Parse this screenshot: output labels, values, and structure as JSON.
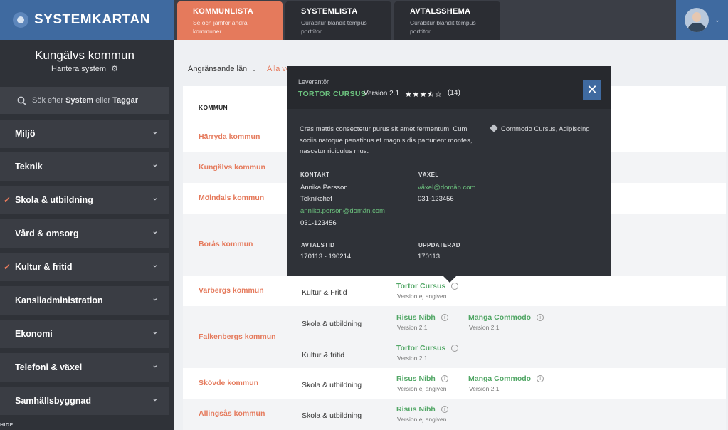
{
  "app": {
    "logo": "SYSTEMKARTAN"
  },
  "tabs": [
    {
      "title": "KOMMUNLISTA",
      "subtitle": "Se och jämför andra kommuner"
    },
    {
      "title": "SYSTEMLISTA",
      "subtitle": "Curabitur blandit tempus porttitor."
    },
    {
      "title": "AVTALSSHEMA",
      "subtitle": "Curabitur blandit tempus porttitor."
    }
  ],
  "sidebar": {
    "municipality": "Kungälvs kommun",
    "manage_label": "Hantera system",
    "search": {
      "prefix": "Sök efter ",
      "bold1": "System",
      "middle": " eller ",
      "bold2": "Taggar"
    },
    "categories": [
      {
        "label": "Miljö",
        "checked": false
      },
      {
        "label": "Teknik",
        "checked": false
      },
      {
        "label": "Skola & utbildning",
        "checked": true
      },
      {
        "label": "Vård & omsorg",
        "checked": false
      },
      {
        "label": "Kultur & fritid",
        "checked": true
      },
      {
        "label": "Kansliadministration",
        "checked": false
      },
      {
        "label": "Ekonomi",
        "checked": false
      },
      {
        "label": "Telefoni & växel",
        "checked": false
      },
      {
        "label": "Samhällsbyggnad",
        "checked": false
      }
    ],
    "hide_label": "HIDE"
  },
  "filter": {
    "neighbors": "Angränsande län",
    "all": "Alla ve"
  },
  "table": {
    "header_kommun": "KOMMUN",
    "rows": [
      {
        "kommun": "Härryda kommun"
      },
      {
        "kommun": "Kungälvs kommun"
      },
      {
        "kommun": "Mölndals kommun"
      },
      {
        "kommun": "Borås kommun"
      },
      {
        "kommun": "Varbergs kommun",
        "area": "Kultur & Fritid",
        "sys1": "Tortor Cursus",
        "ver1": "Version ej angiven"
      },
      {
        "kommun": "Falkenbergs kommun",
        "area": "Skola & utbildning",
        "sys1": "Risus Nibh",
        "ver1": "Version 2.1",
        "sys2": "Manga Commodo",
        "ver2": "Version 2.1",
        "area_b": "Kultur & fritid",
        "sys1_b": "Tortor Cursus",
        "ver1_b": "Version 2.1"
      },
      {
        "kommun": "Skövde kommun",
        "area": "Skola & utbildning",
        "sys1": "Risus Nibh",
        "ver1": "Version ej angiven",
        "sys2": "Manga Commodo",
        "ver2": "Version 2.1"
      },
      {
        "kommun": "Allingsås kommun",
        "area": "Skola & utbildning",
        "sys1": "Risus Nibh",
        "ver1": "Version ej angiven"
      }
    ]
  },
  "popup": {
    "supplier_label": "Leverantör",
    "system": "TORTOR CURSUS",
    "version": "Version 2.1",
    "stars": "★★★⯪☆",
    "rating_count": "(14)",
    "description": "Cras mattis consectetur purus sit amet fermentum. Cum sociis natoque penatibus et magnis dis parturient montes, nascetur ridiculus mus.",
    "tags": "Commodo Cursus, Adipiscing",
    "contact_label": "KONTAKT",
    "contact_name": "Annika Persson",
    "contact_title": "Teknikchef",
    "contact_email": "annika.person@domän.com",
    "contact_phone": "031-123456",
    "switch_label": "VÄXEL",
    "switch_email": "växel@domän.com",
    "switch_phone": "031-123456",
    "contract_label": "AVTALSTID",
    "contract_value": "170113 - 190214",
    "updated_label": "UPPDATERAD",
    "updated_value": "170113"
  }
}
